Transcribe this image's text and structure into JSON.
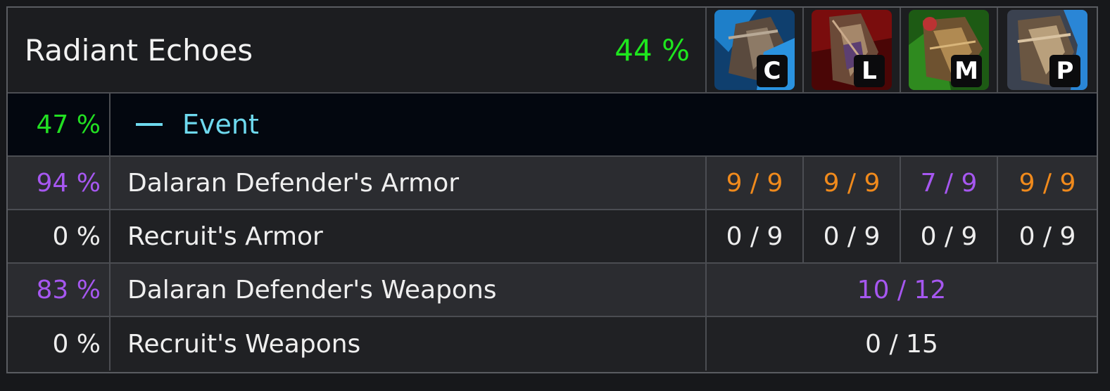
{
  "header": {
    "title": "Radiant Echoes",
    "progress": "44 %"
  },
  "characters": [
    {
      "badge": "C",
      "icon": "armor-icon-blue"
    },
    {
      "badge": "L",
      "icon": "armor-icon-red"
    },
    {
      "badge": "M",
      "icon": "armor-icon-green"
    },
    {
      "badge": "P",
      "icon": "armor-icon-tan"
    }
  ],
  "event": {
    "progress": "47 %",
    "label": "Event",
    "icon": "collapse-icon"
  },
  "rows": [
    {
      "pct": "94 %",
      "name": "Dalaran Defender's Armor",
      "values": [
        "9 / 9",
        "9 / 9",
        "7 / 9",
        "9 / 9"
      ]
    },
    {
      "pct": "0 %",
      "name": "Recruit's Armor",
      "values": [
        "0 / 9",
        "0 / 9",
        "0 / 9",
        "0 / 9"
      ]
    },
    {
      "pct": "83 %",
      "name": "Dalaran Defender's Weapons",
      "combined": "10 / 12"
    },
    {
      "pct": "0 %",
      "name": "Recruit's Weapons",
      "combined": "0 / 15"
    }
  ],
  "colors": {
    "complete": "#f08a1c",
    "in_progress": "#a657f0",
    "zero": "#eeeeee",
    "good_progress": "#1ee61e",
    "event": "#6ed9ee"
  }
}
